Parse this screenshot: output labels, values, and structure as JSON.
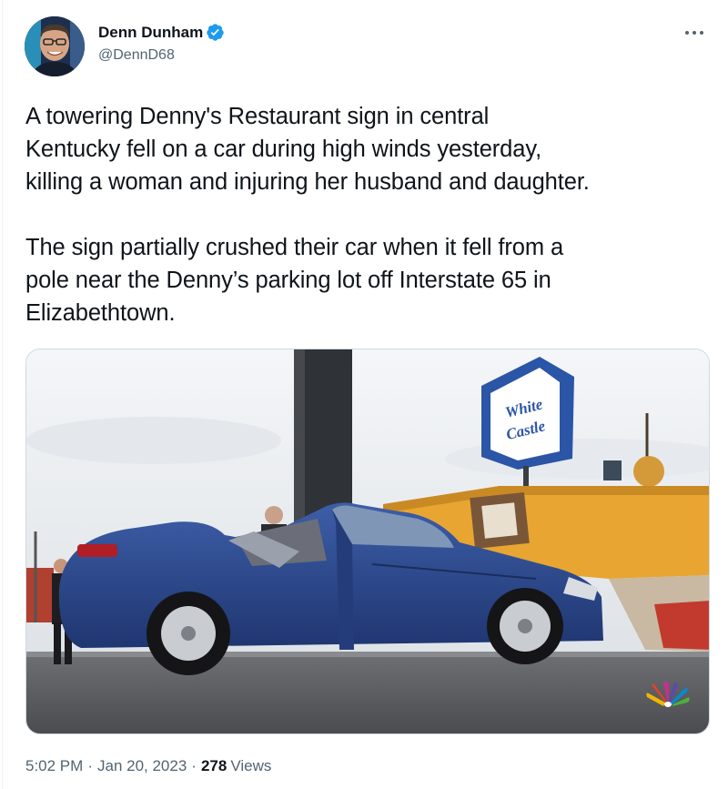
{
  "user": {
    "display_name": "Denn Dunham",
    "handle": "@DennD68",
    "verified": true
  },
  "tweet": {
    "paragraphs": [
      "A towering Denny's Restaurant sign in central\nKentucky fell on a car during high winds yesterday,\nkilling a woman and injuring her husband and daughter.",
      "The sign partially crushed their car when it fell from a\npole near the Denny’s parking lot off Interstate 65 in\nElizabethtown."
    ],
    "time": "5:02 PM",
    "date": "Jan 20, 2023",
    "views_count": "278",
    "views_label": "Views"
  },
  "media": {
    "sign_text_line1": "White",
    "sign_text_line2": "Castle"
  },
  "colors": {
    "verified_blue": "#1d9bf0",
    "secondary_text": "#536471",
    "primary_text": "#0f1419",
    "car_blue": "#2b4a8c",
    "sign_orange": "#e8a532"
  },
  "icons": [
    "verified-badge-icon",
    "more-options-icon",
    "nbc-peacock-logo"
  ]
}
